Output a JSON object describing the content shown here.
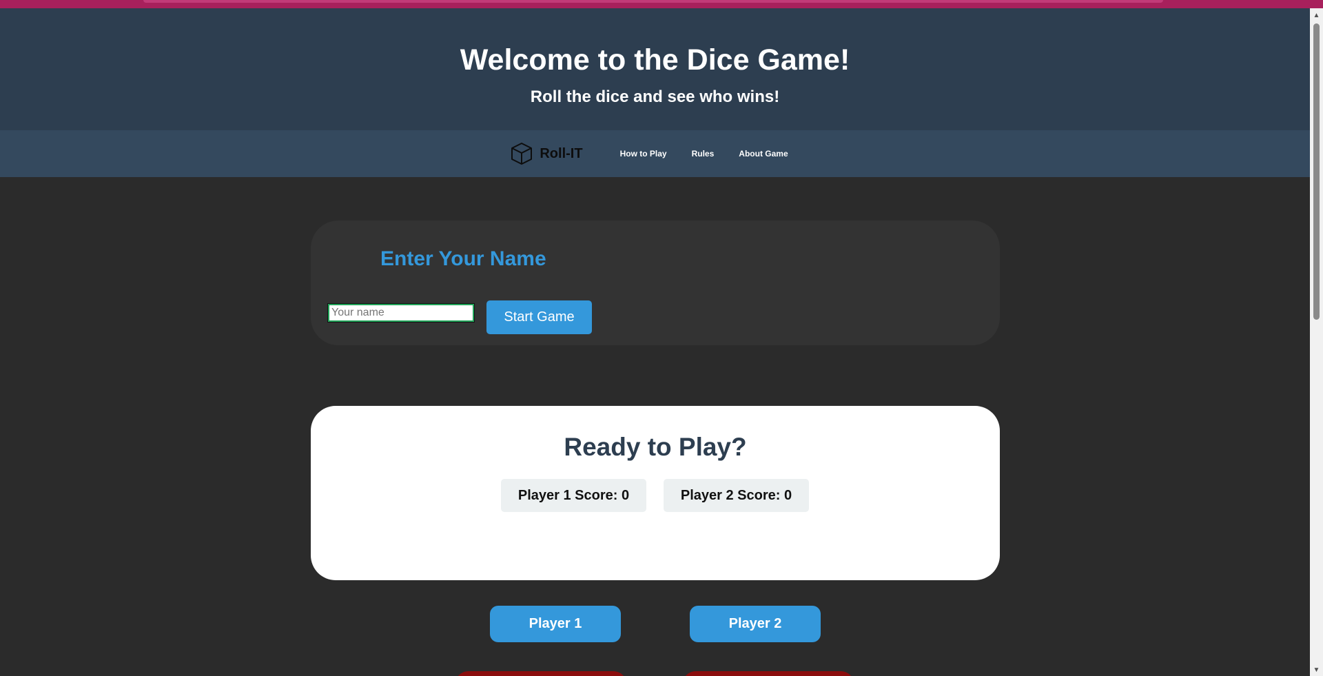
{
  "hero": {
    "title": "Welcome to the Dice Game!",
    "subtitle": "Roll the dice and see who wins!"
  },
  "nav": {
    "brand_icon": "dice-cube-icon",
    "brand_label": "Roll-IT",
    "links": [
      "How to Play",
      "Rules",
      "About Game"
    ]
  },
  "name_form": {
    "heading": "Enter Your Name",
    "placeholder": "Your name",
    "value": "",
    "start_label": "Start Game"
  },
  "game": {
    "status": "Ready to Play?",
    "player1_score": "Player 1 Score: 0",
    "player2_score": "Player 2 Score: 0"
  },
  "controls": {
    "player1_label": "Player 1",
    "player2_label": "Player 2"
  },
  "colors": {
    "accent": "#3498db",
    "hero_bg": "#2d3e50",
    "nav_bg": "#34495e",
    "page_bg": "#2b2b2b",
    "danger": "#8b0d0d"
  }
}
